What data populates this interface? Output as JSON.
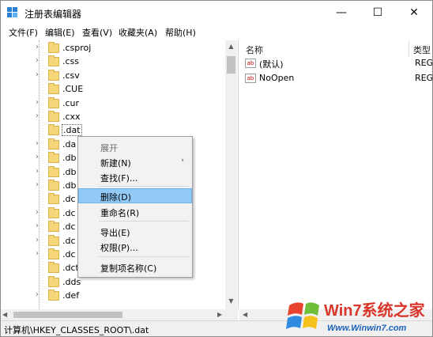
{
  "window": {
    "title": "注册表编辑器",
    "minimize_glyph": "—",
    "maximize_glyph": "☐",
    "close_glyph": "✕"
  },
  "menubar": {
    "items": [
      "文件(F)",
      "编辑(E)",
      "查看(V)",
      "收藏夹(A)",
      "帮助(H)"
    ]
  },
  "tree": {
    "items": [
      {
        "label": ".csproj",
        "expandable": true
      },
      {
        "label": ".css",
        "expandable": true
      },
      {
        "label": ".csv",
        "expandable": true
      },
      {
        "label": ".CUE",
        "expandable": false
      },
      {
        "label": ".cur",
        "expandable": true
      },
      {
        "label": ".cxx",
        "expandable": true
      },
      {
        "label": ".dat",
        "expandable": false,
        "selected": true
      },
      {
        "label": ".da",
        "expandable": true
      },
      {
        "label": ".db",
        "expandable": true
      },
      {
        "label": ".db",
        "expandable": true
      },
      {
        "label": ".db",
        "expandable": true
      },
      {
        "label": ".dc",
        "expandable": false
      },
      {
        "label": ".dc",
        "expandable": true
      },
      {
        "label": ".dc",
        "expandable": true
      },
      {
        "label": ".dc",
        "expandable": true
      },
      {
        "label": ".dc",
        "expandable": true
      },
      {
        "label": ".dct",
        "expandable": false
      },
      {
        "label": ".dds",
        "expandable": false
      },
      {
        "label": ".def",
        "expandable": true
      }
    ],
    "chevron_glyph": "›"
  },
  "values_pane": {
    "col_name": "名称",
    "col_type": "类型",
    "rows": [
      {
        "name": "(默认)",
        "type": "REG",
        "icon": "ab"
      },
      {
        "name": "NoOpen",
        "type": "REG",
        "icon": "ab"
      }
    ]
  },
  "context_menu": {
    "items": [
      {
        "label": "展开",
        "disabled": true
      },
      {
        "label": "新建(N)",
        "submenu": true
      },
      {
        "label": "查找(F)..."
      },
      {
        "label": "删除(D)",
        "highlighted": true
      },
      {
        "label": "重命名(R)"
      },
      {
        "label": "导出(E)"
      },
      {
        "label": "权限(P)..."
      },
      {
        "label": "复制项名称(C)"
      }
    ],
    "submenu_arrow": "›"
  },
  "statusbar": {
    "path": "计算机\\HKEY_CLASSES_ROOT\\.dat"
  },
  "scroll": {
    "up": "▲",
    "down": "▼",
    "left": "◀",
    "right": "▶"
  },
  "watermark": {
    "brand": "Win7系统之家",
    "url": "Www.Winwin7.com"
  },
  "colors": {
    "selection": "#91c9f7",
    "folder": "#f5d77a",
    "watermark_red": "#d9362b",
    "watermark_blue": "#1c63b7"
  }
}
